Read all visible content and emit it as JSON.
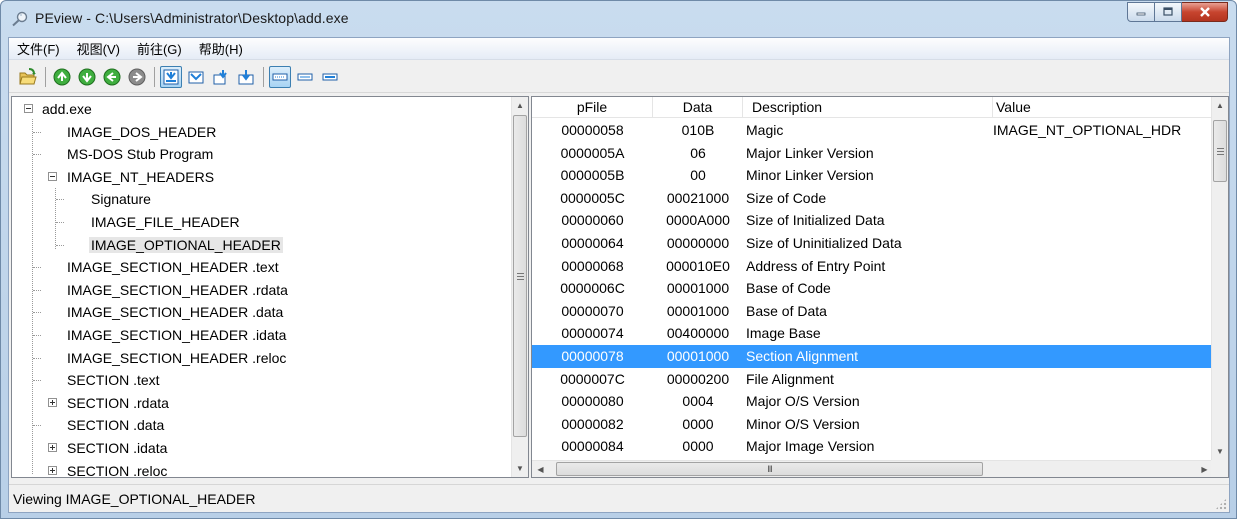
{
  "window": {
    "title": "PEview - C:\\Users\\Administrator\\Desktop\\add.exe"
  },
  "menu": [
    "文件(F)",
    "视图(V)",
    "前往(G)",
    "帮助(H)"
  ],
  "toolbar": {
    "buttons": [
      {
        "icon": "open-file-icon"
      },
      {
        "icon": "go-up-icon"
      },
      {
        "icon": "go-down-icon"
      },
      {
        "icon": "go-back-icon"
      },
      {
        "icon": "go-forward-icon"
      },
      {
        "icon": "view-mode-1-icon",
        "pressed": true
      },
      {
        "icon": "view-mode-2-icon"
      },
      {
        "icon": "view-mode-3-icon"
      },
      {
        "icon": "view-mode-4-icon"
      },
      {
        "icon": "format-byte-icon",
        "pressed": true
      },
      {
        "icon": "format-word-icon"
      },
      {
        "icon": "format-dword-icon"
      }
    ]
  },
  "tree": [
    {
      "label": "add.exe",
      "expander": "minus"
    },
    {
      "label": "IMAGE_DOS_HEADER"
    },
    {
      "label": "MS-DOS Stub Program"
    },
    {
      "label": "IMAGE_NT_HEADERS",
      "expander": "minus"
    },
    {
      "label": "Signature"
    },
    {
      "label": "IMAGE_FILE_HEADER"
    },
    {
      "label": "IMAGE_OPTIONAL_HEADER",
      "selected": true
    },
    {
      "label": "IMAGE_SECTION_HEADER .text"
    },
    {
      "label": "IMAGE_SECTION_HEADER .rdata"
    },
    {
      "label": "IMAGE_SECTION_HEADER .data"
    },
    {
      "label": "IMAGE_SECTION_HEADER .idata"
    },
    {
      "label": "IMAGE_SECTION_HEADER .reloc"
    },
    {
      "label": "SECTION .text"
    },
    {
      "label": "SECTION .rdata",
      "expander": "plus"
    },
    {
      "label": "SECTION .data"
    },
    {
      "label": "SECTION .idata",
      "expander": "plus"
    },
    {
      "label": "SECTION .reloc",
      "expander": "plus"
    }
  ],
  "list": {
    "columns": [
      "pFile",
      "Data",
      "Description",
      "Value"
    ],
    "rows": [
      {
        "pfile": "00000058",
        "data": "010B",
        "desc": "Magic",
        "value": "IMAGE_NT_OPTIONAL_HDR"
      },
      {
        "pfile": "0000005A",
        "data": "06",
        "desc": "Major Linker Version",
        "value": ""
      },
      {
        "pfile": "0000005B",
        "data": "00",
        "desc": "Minor Linker Version",
        "value": ""
      },
      {
        "pfile": "0000005C",
        "data": "00021000",
        "desc": "Size of Code",
        "value": ""
      },
      {
        "pfile": "00000060",
        "data": "0000A000",
        "desc": "Size of Initialized Data",
        "value": ""
      },
      {
        "pfile": "00000064",
        "data": "00000000",
        "desc": "Size of Uninitialized Data",
        "value": ""
      },
      {
        "pfile": "00000068",
        "data": "000010E0",
        "desc": "Address of Entry Point",
        "value": ""
      },
      {
        "pfile": "0000006C",
        "data": "00001000",
        "desc": "Base of Code",
        "value": ""
      },
      {
        "pfile": "00000070",
        "data": "00001000",
        "desc": "Base of Data",
        "value": ""
      },
      {
        "pfile": "00000074",
        "data": "00400000",
        "desc": "Image Base",
        "value": ""
      },
      {
        "pfile": "00000078",
        "data": "00001000",
        "desc": "Section Alignment",
        "value": "",
        "selected": true
      },
      {
        "pfile": "0000007C",
        "data": "00000200",
        "desc": "File Alignment",
        "value": ""
      },
      {
        "pfile": "00000080",
        "data": "0004",
        "desc": "Major O/S Version",
        "value": ""
      },
      {
        "pfile": "00000082",
        "data": "0000",
        "desc": "Minor O/S Version",
        "value": ""
      },
      {
        "pfile": "00000084",
        "data": "0000",
        "desc": "Major Image Version",
        "value": ""
      }
    ]
  },
  "status": {
    "text": "Viewing IMAGE_OPTIONAL_HEADER"
  },
  "scroll": {
    "hscroll_glyph": "III"
  }
}
